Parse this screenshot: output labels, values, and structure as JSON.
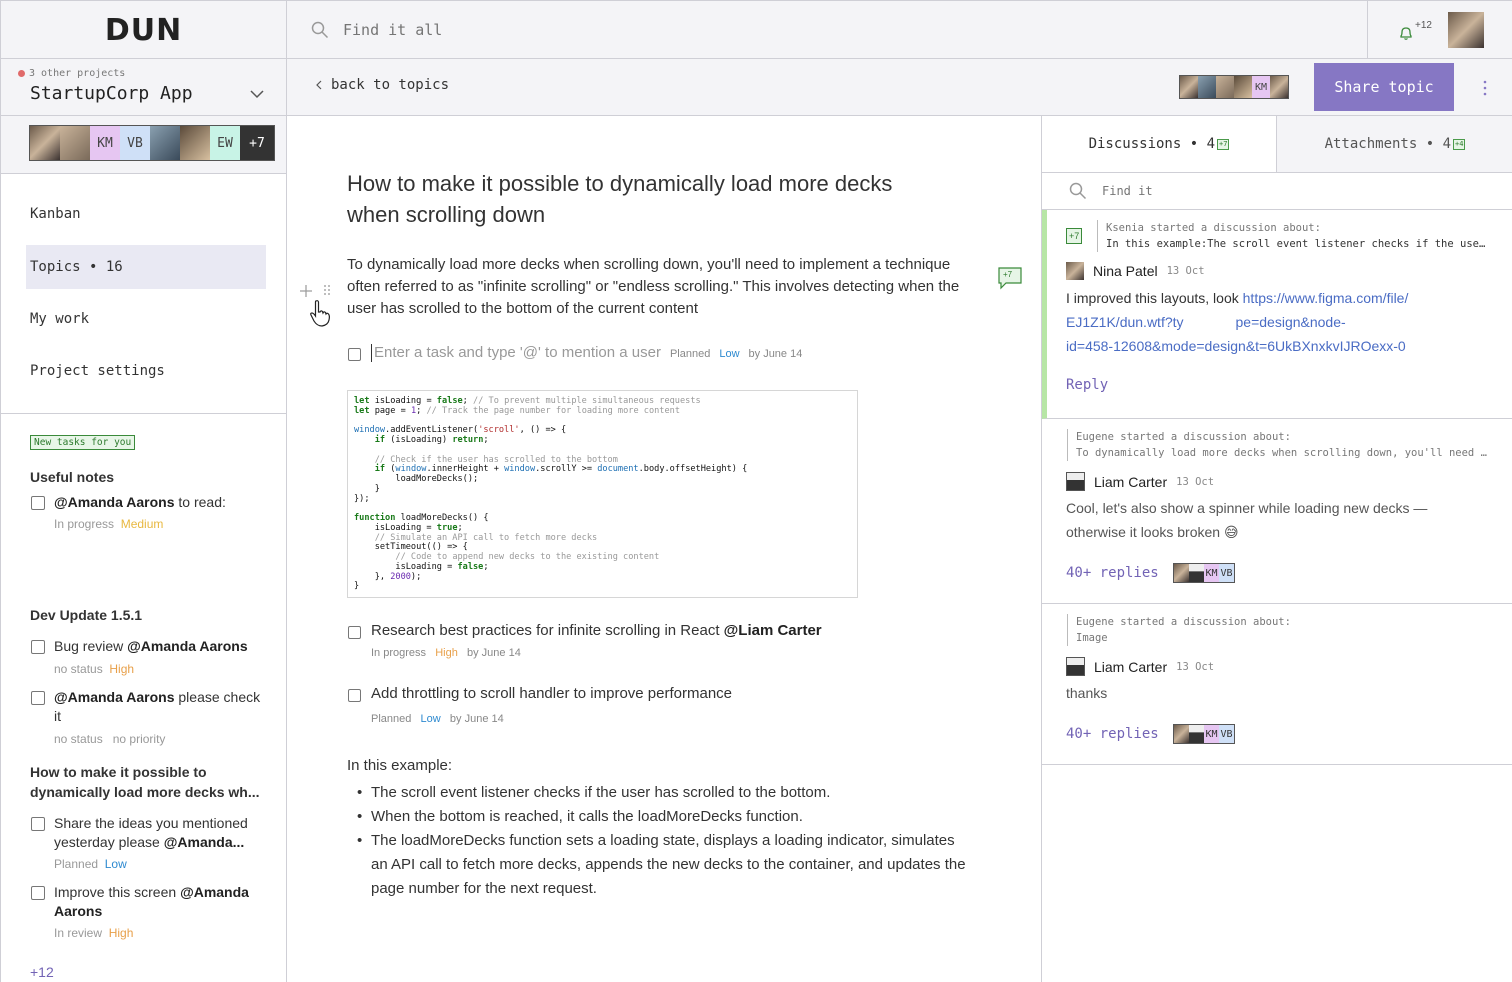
{
  "app": {
    "logo": "DUN"
  },
  "search": {
    "placeholder": "Find it all"
  },
  "notifications": {
    "count": "+12"
  },
  "project": {
    "other_projects": "3 other projects",
    "name": "StartupCorp App",
    "members": [
      "KM",
      "VB",
      "EW"
    ],
    "members_more": "+7"
  },
  "nav": {
    "items": [
      {
        "label": "Kanban"
      },
      {
        "label": "Topics • 16"
      },
      {
        "label": "My work"
      },
      {
        "label": "Project settings"
      }
    ]
  },
  "sidebar_tasks": {
    "badge": "New tasks for you",
    "groups": [
      {
        "title": "Useful notes"
      },
      {
        "title": "Dev Update 1.5.1"
      },
      {
        "title": "How to make it possible to dynamically load more decks wh..."
      }
    ],
    "items": [
      {
        "mention": "@Amanda Aarons",
        "text": " to read:",
        "status": "In progress",
        "priority": "Medium"
      },
      {
        "text": "Bug review ",
        "mention": "@Amanda Aarons",
        "status": "no status",
        "priority": "High"
      },
      {
        "mention": "@Amanda Aarons",
        "text": " please check it",
        "status": "no status",
        "priority": "no priority"
      },
      {
        "text": "Share the ideas you mentioned yesterday please ",
        "mention": "@Amanda...",
        "status": "Planned",
        "priority": "Low"
      },
      {
        "text": "Improve this screen ",
        "mention": "@Amanda Aarons",
        "status": "In review",
        "priority": "High"
      }
    ],
    "more": "+12"
  },
  "subheader": {
    "back": "back to topics",
    "viewers": [
      "KM"
    ],
    "share_label": "Share topic"
  },
  "topic": {
    "title": "How to make it possible to dynamically load more decks when scrolling down",
    "intro": "To dynamically load more decks when scrolling down, you'll need to implement a technique often referred to as \"infinite scrolling\" or \"endless scrolling.\" This involves detecting when the user has scrolled to the bottom of the current content",
    "comment_badge": "+7",
    "new_task": {
      "placeholder": "Enter a task and type '@' to mention a user",
      "status": "Planned",
      "priority": "Low",
      "due": "by June 14"
    },
    "tasks": [
      {
        "text": "Research best practices for infinite scrolling in React ",
        "mention": "@Liam Carter",
        "status": "In progress",
        "priority": "High",
        "due": "by June 14"
      },
      {
        "text": "Add throttling to scroll handler to improve performance",
        "status": "Planned",
        "priority": "Low",
        "due": "by June 14"
      }
    ],
    "example_heading": "In this example:",
    "bullets": [
      "The scroll event listener checks if the user has scrolled to the bottom.",
      "When the bottom is reached, it calls the loadMoreDecks function.",
      "The loadMoreDecks function sets a loading state, displays a loading indicator, simulates an API call to fetch more decks, appends the new decks to the container, and updates the page number for the next request."
    ]
  },
  "panel": {
    "tabs": [
      {
        "label": "Discussions • 4",
        "badge": "+7"
      },
      {
        "label": "Attachments • 4",
        "badge": "+4"
      }
    ],
    "search_placeholder": "Find it",
    "discussions": [
      {
        "badge": "+7",
        "intro_line1": "Ksenia started a discussion about:",
        "intro_line2": "In this example:The scroll event listener checks if the user has scrolled to the bottom.",
        "author": "Nina Patel",
        "date": "13 Oct",
        "body": "I improved this layouts, look ",
        "link_line1": "https://www.figma.com/file/",
        "link_line2a": "EJ1Z1K/dun.wtf?ty",
        "link_line2b": "pe=design&node-",
        "link_line3": "id=458-12608&mode=design&t=6UkBXnxkvIJROexx-0",
        "reply": "Reply"
      },
      {
        "intro_line1": "Eugene started a discussion about:",
        "intro_line2": "To dynamically load more decks when scrolling down, you'll need to implement",
        "author": "Liam Carter",
        "date": "13 Oct",
        "body": "Cool, let's also show a spinner while loading new decks — otherwise it looks broken 😅",
        "replies": "40+ replies",
        "reply_members": [
          "KM",
          "VB"
        ]
      },
      {
        "intro_line1": "Eugene started a discussion about:",
        "intro_line2": "Image",
        "author": "Liam Carter",
        "date": "13 Oct",
        "body": "thanks",
        "replies": "40+ replies",
        "reply_members": [
          "KM",
          "VB"
        ]
      }
    ]
  },
  "colors": {
    "accent": "#8677c4",
    "link": "#4a6cc4",
    "high": "#e8a04a",
    "medium": "#e8b840",
    "low": "#2e8ad0",
    "green": "#4a9a4a"
  }
}
